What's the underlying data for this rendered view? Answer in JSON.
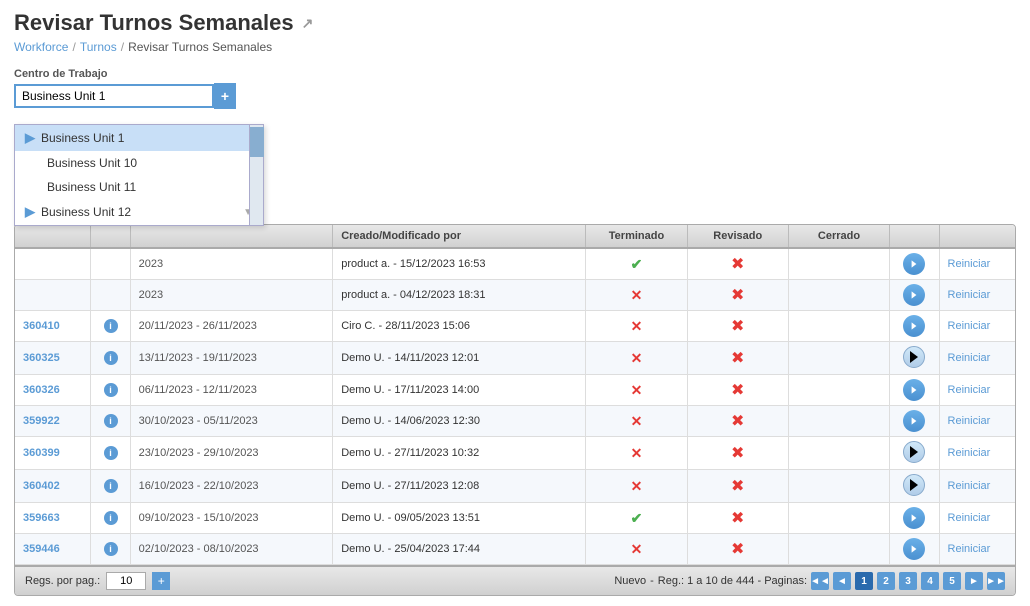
{
  "page": {
    "title": "Revisar Turnos Semanales",
    "breadcrumb": {
      "items": [
        "Workforce",
        "Turnos",
        "Revisar Turnos Semanales"
      ]
    }
  },
  "filter": {
    "label": "Centro de Trabajo",
    "value": "Business Unit 1",
    "add_btn": "+",
    "dropdown": {
      "items": [
        {
          "label": "Business Unit 1",
          "selected": true,
          "arrow": true
        },
        {
          "label": "Business Unit 10",
          "selected": false,
          "arrow": false
        },
        {
          "label": "Business Unit 11",
          "selected": false,
          "arrow": false
        },
        {
          "label": "Business Unit 12",
          "selected": false,
          "arrow": true
        }
      ]
    }
  },
  "table": {
    "columns": [
      "",
      "",
      "Creado/Modificado por",
      "Terminado",
      "Revisado",
      "Cerrado",
      "",
      ""
    ],
    "rows": [
      {
        "id": "",
        "date_range": "2023",
        "creator": "product a. - 15/12/2023 16:53",
        "terminado": "check",
        "revisado": "x",
        "cerrado": "",
        "action": "Reiniciar"
      },
      {
        "id": "",
        "date_range": "2023",
        "creator": "product a. - 04/12/2023 18:31",
        "terminado": "x",
        "revisado": "x",
        "cerrado": "",
        "action": "Reiniciar"
      },
      {
        "id": "360410",
        "date_range": "20/11/2023 - 26/11/2023",
        "creator": "Ciro C. - 28/11/2023 15:06",
        "terminado": "x",
        "revisado": "x",
        "cerrado": "",
        "action": "Reiniciar"
      },
      {
        "id": "360325",
        "date_range": "13/11/2023 - 19/11/2023",
        "creator": "Demo U. - 14/11/2023 12:01",
        "terminado": "x",
        "revisado": "x",
        "cerrado": "",
        "action": "Reiniciar"
      },
      {
        "id": "360326",
        "date_range": "06/11/2023 - 12/11/2023",
        "creator": "Demo U. - 17/11/2023 14:00",
        "terminado": "x",
        "revisado": "x",
        "cerrado": "",
        "action": "Reiniciar"
      },
      {
        "id": "359922",
        "date_range": "30/10/2023 - 05/11/2023",
        "creator": "Demo U. - 14/06/2023 12:30",
        "terminado": "x",
        "revisado": "x",
        "cerrado": "",
        "action": "Reiniciar"
      },
      {
        "id": "360399",
        "date_range": "23/10/2023 - 29/10/2023",
        "creator": "Demo U. - 27/11/2023 10:32",
        "terminado": "x",
        "revisado": "x",
        "cerrado": "",
        "action": "Reiniciar"
      },
      {
        "id": "360402",
        "date_range": "16/10/2023 - 22/10/2023",
        "creator": "Demo U. - 27/11/2023 12:08",
        "terminado": "x",
        "revisado": "x",
        "cerrado": "",
        "action": "Reiniciar"
      },
      {
        "id": "359663",
        "date_range": "09/10/2023 - 15/10/2023",
        "creator": "Demo U. - 09/05/2023 13:51",
        "terminado": "check",
        "revisado": "x",
        "cerrado": "",
        "action": "Reiniciar"
      },
      {
        "id": "359446",
        "date_range": "02/10/2023 - 08/10/2023",
        "creator": "Demo U. - 25/04/2023 17:44",
        "terminado": "x",
        "revisado": "x",
        "cerrado": "",
        "action": "Reiniciar"
      }
    ]
  },
  "footer": {
    "regs_label": "Regs. por pag.:",
    "regs_value": "10",
    "nuevo_label": "Nuevo",
    "separator": "-",
    "reg_info": "Reg.: 1 a 10 de 444 - Paginas:",
    "pages": [
      "1",
      "2",
      "3",
      "4",
      "5"
    ]
  }
}
